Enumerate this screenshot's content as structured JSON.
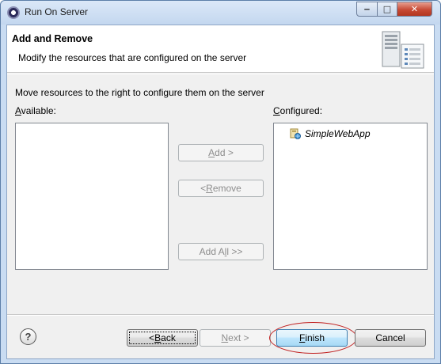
{
  "window": {
    "title": "Run On Server",
    "minimize_glyph": "‒",
    "maximize_glyph": "□",
    "close_glyph": "✕"
  },
  "header": {
    "title": "Add and Remove",
    "description": "Modify the resources that are configured on the server",
    "icon": "server-icon"
  },
  "instructions": "Move resources to the right to configure them on the server",
  "available": {
    "label_mnemonic": "A",
    "label_rest": "vailable:",
    "items": []
  },
  "configured": {
    "label_mnemonic": "C",
    "label_rest": "onfigured:",
    "items": [
      {
        "name": "SimpleWebApp",
        "icon": "web-project-icon"
      }
    ]
  },
  "transfer_buttons": {
    "add": {
      "pre": "",
      "mnemonic": "A",
      "post": "dd >"
    },
    "remove": {
      "pre": "< ",
      "mnemonic": "R",
      "post": "emove"
    },
    "add_all": {
      "pre": "Add A",
      "mnemonic": "l",
      "post": "l >>"
    }
  },
  "footer": {
    "help_glyph": "?",
    "back": {
      "pre": "< ",
      "mnemonic": "B",
      "post": "ack"
    },
    "next": {
      "pre": "",
      "mnemonic": "N",
      "post": "ext >"
    },
    "finish": {
      "pre": "",
      "mnemonic": "F",
      "post": "inish"
    },
    "cancel": "Cancel"
  },
  "colors": {
    "title_bar": "#c3d7ef",
    "close_button": "#c74a35",
    "highlight_ring": "#c02020"
  }
}
